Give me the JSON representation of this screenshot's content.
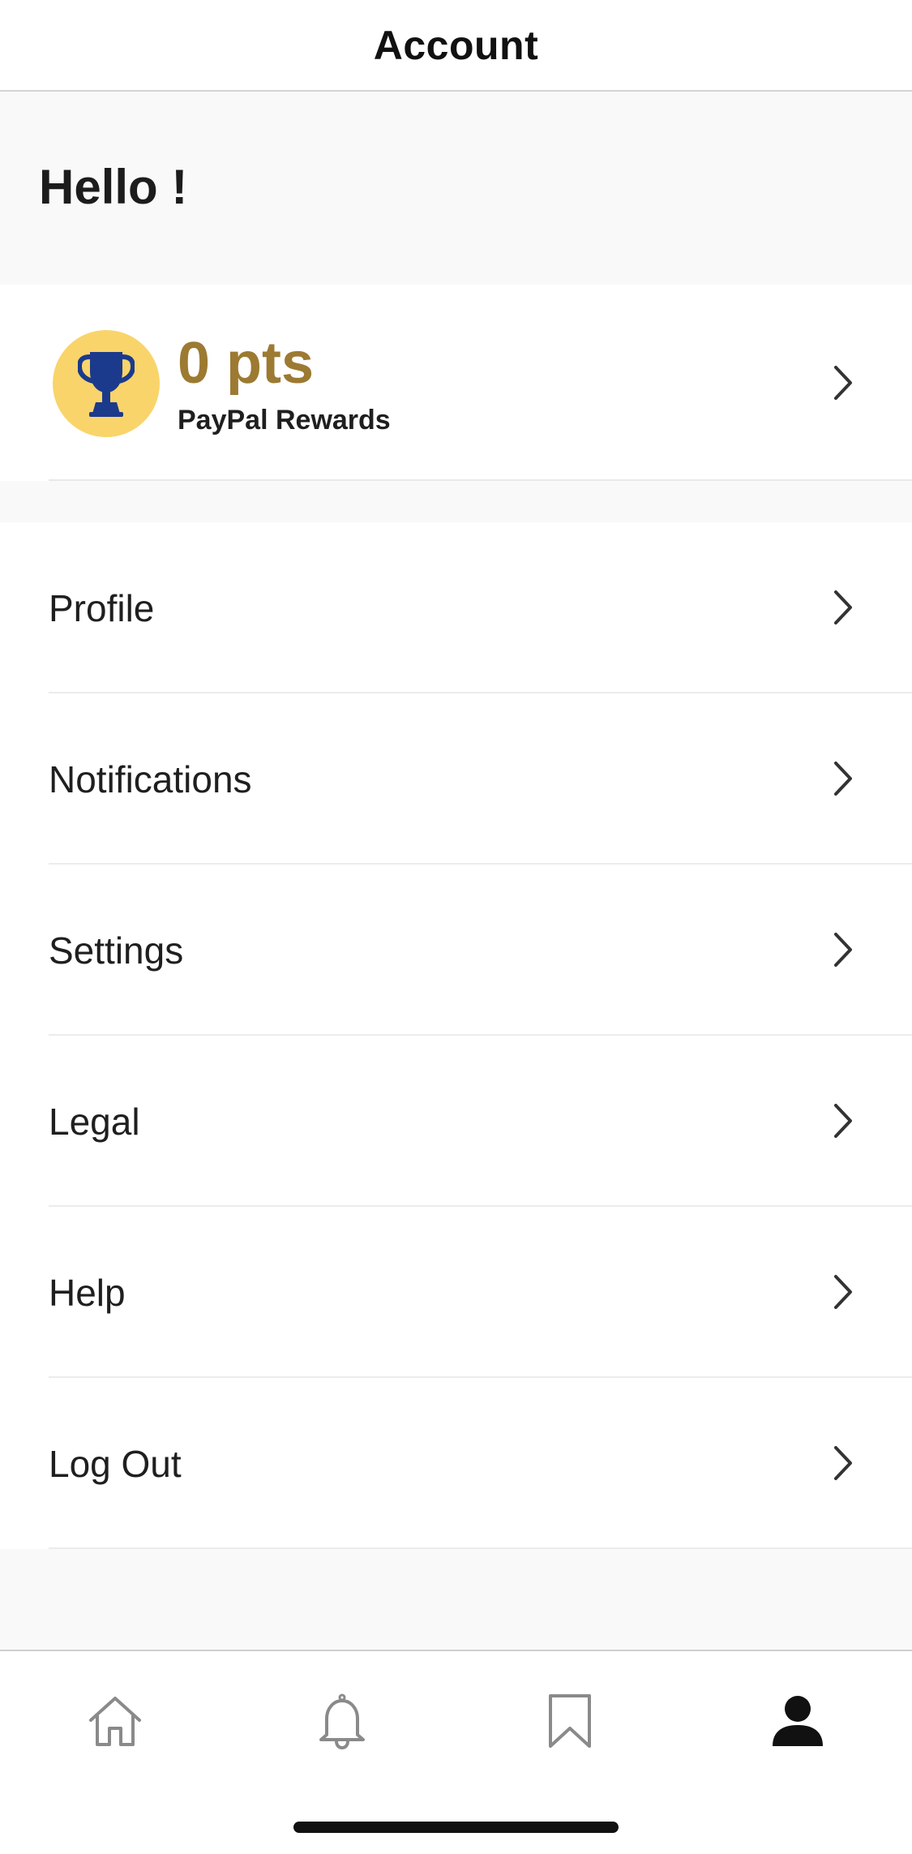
{
  "header": {
    "title": "Account"
  },
  "greeting": {
    "text": "Hello !"
  },
  "rewards": {
    "points": "0 pts",
    "label": "PayPal Rewards",
    "icon": "trophy-icon",
    "badge_color": "#f9d46a",
    "points_color": "#9c7a32",
    "trophy_color": "#1c3a8c"
  },
  "menu": {
    "items": [
      {
        "label": "Profile"
      },
      {
        "label": "Notifications"
      },
      {
        "label": "Settings"
      },
      {
        "label": "Legal"
      },
      {
        "label": "Help"
      },
      {
        "label": "Log Out"
      }
    ]
  },
  "tabbar": {
    "tabs": [
      {
        "icon": "home-icon",
        "active": false
      },
      {
        "icon": "bell-icon",
        "active": false
      },
      {
        "icon": "bookmark-icon",
        "active": false
      },
      {
        "icon": "person-icon",
        "active": true
      }
    ]
  }
}
